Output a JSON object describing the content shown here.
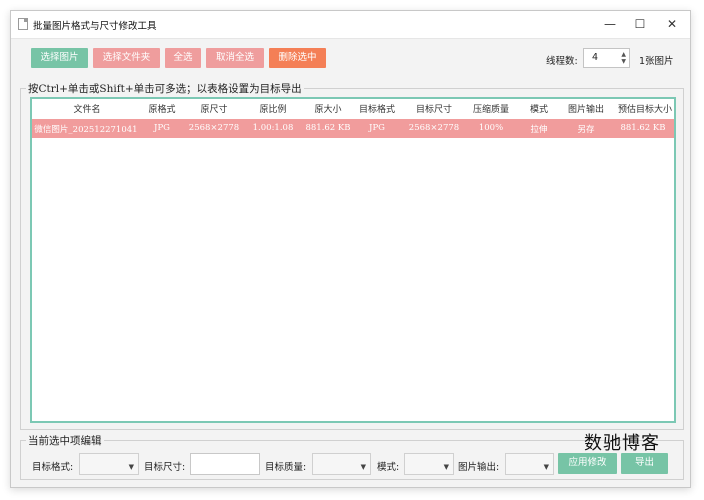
{
  "window": {
    "title": "批量图片格式与尺寸修改工具",
    "minimize": "—",
    "maximize": "☐",
    "close": "✕"
  },
  "toolbar": {
    "select_images": "选择图片",
    "select_folder": "选择文件夹",
    "select_all": "全选",
    "deselect_all": "取消全选",
    "delete_selected": "删除选中",
    "threads_label": "线程数:",
    "threads_value": "4",
    "image_count": "1张图片"
  },
  "colors": {
    "green": "#77c4a6",
    "pink": "#ef9d9d",
    "orange": "#f47f56",
    "row_selected": "#f19c9c",
    "table_border": "#7cc8b4"
  },
  "table_group": {
    "legend": "按Ctrl+单击或Shift+单击可多选；以表格设置为目标导出",
    "columns": [
      "文件名",
      "原格式",
      "原尺寸",
      "原比例",
      "原大小",
      "目标格式",
      "目标尺寸",
      "压缩质量",
      "模式",
      "图片输出",
      "预估目标大小"
    ],
    "rows": [
      [
        "微信图片_202512271041",
        "JPG",
        "2568×2778",
        "1.00:1.08",
        "881.62 KB",
        "JPG",
        "2568×2778",
        "100%",
        "拉伸",
        "另存",
        "881.62 KB"
      ]
    ]
  },
  "edit_group": {
    "legend": "当前选中项编辑",
    "target_format_label": "目标格式:",
    "target_size_label": "目标尺寸:",
    "target_quality_label": "目标质量:",
    "mode_label": "模式:",
    "output_label": "图片输出:",
    "apply_button": "应用修改",
    "export_button": "导出"
  },
  "watermark": "数驰博客",
  "icons": {
    "app": "document-icon",
    "dropdown": "chevron-down-icon",
    "spin_up": "triangle-up-icon",
    "spin_down": "triangle-down-icon"
  }
}
